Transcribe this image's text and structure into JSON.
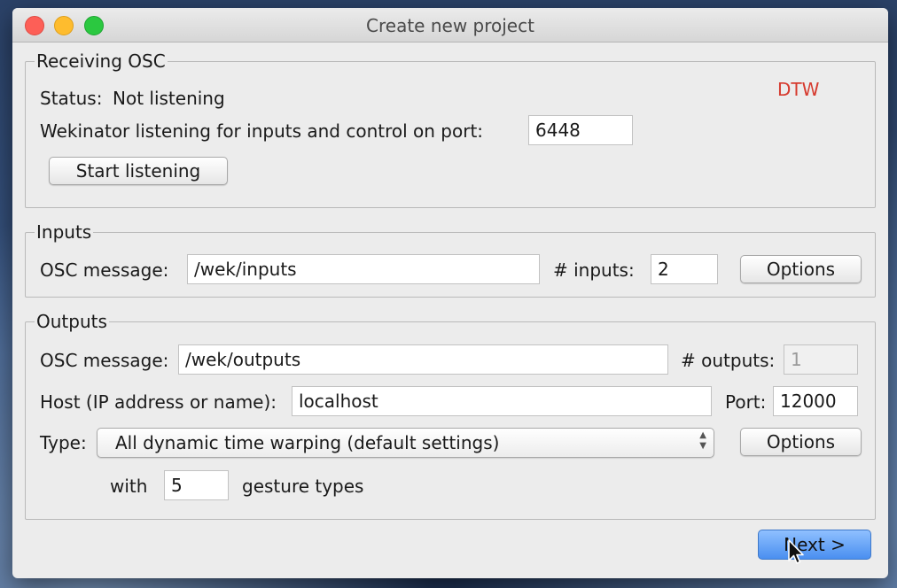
{
  "window": {
    "title": "Create new project"
  },
  "receiving_osc": {
    "legend": "Receiving OSC",
    "status_label": "Status:",
    "status_value": "Not listening",
    "annotation": "DTW",
    "annotation_color": "#d63b2f",
    "port_label": "Wekinator listening for inputs and control on port:",
    "port_value": "6448",
    "start_button": "Start listening"
  },
  "inputs": {
    "legend": "Inputs",
    "osc_label": "OSC message:",
    "osc_value": "/wek/inputs",
    "count_label": "# inputs:",
    "count_value": "2",
    "options_button": "Options"
  },
  "outputs": {
    "legend": "Outputs",
    "osc_label": "OSC message:",
    "osc_value": "/wek/outputs",
    "count_label": "# outputs:",
    "count_value": "1",
    "host_label": "Host (IP address or name):",
    "host_value": "localhost",
    "port_label": "Port:",
    "port_value": "12000",
    "type_label": "Type:",
    "type_value": "All dynamic time warping (default settings)",
    "options_button": "Options",
    "with_label": "with",
    "gesture_count": "5",
    "gesture_label": "gesture types"
  },
  "footer": {
    "next_button": "Next >",
    "accent_color": "#4a8ff0"
  }
}
